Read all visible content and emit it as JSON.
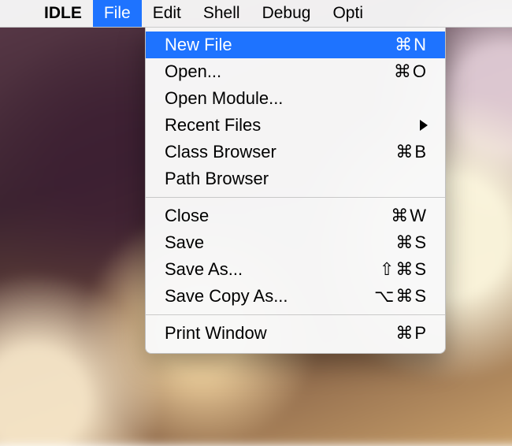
{
  "menubar": {
    "apple_glyph": "",
    "app_name": "IDLE",
    "items": [
      {
        "label": "File",
        "active": true
      },
      {
        "label": "Edit",
        "active": false
      },
      {
        "label": "Shell",
        "active": false
      },
      {
        "label": "Debug",
        "active": false
      },
      {
        "label": "Opti",
        "active": false
      }
    ]
  },
  "file_menu": {
    "groups": [
      [
        {
          "label": "New File",
          "shortcut": "⌘N",
          "selected": true
        },
        {
          "label": "Open...",
          "shortcut": "⌘O"
        },
        {
          "label": "Open Module..."
        },
        {
          "label": "Recent Files",
          "submenu": true
        },
        {
          "label": "Class Browser",
          "shortcut": "⌘B"
        },
        {
          "label": "Path Browser"
        }
      ],
      [
        {
          "label": "Close",
          "shortcut": "⌘W"
        },
        {
          "label": "Save",
          "shortcut": "⌘S"
        },
        {
          "label": "Save As...",
          "shortcut": "⇧⌘S"
        },
        {
          "label": "Save Copy As...",
          "shortcut": "⌥⌘S"
        }
      ],
      [
        {
          "label": "Print Window",
          "shortcut": "⌘P"
        }
      ]
    ]
  }
}
